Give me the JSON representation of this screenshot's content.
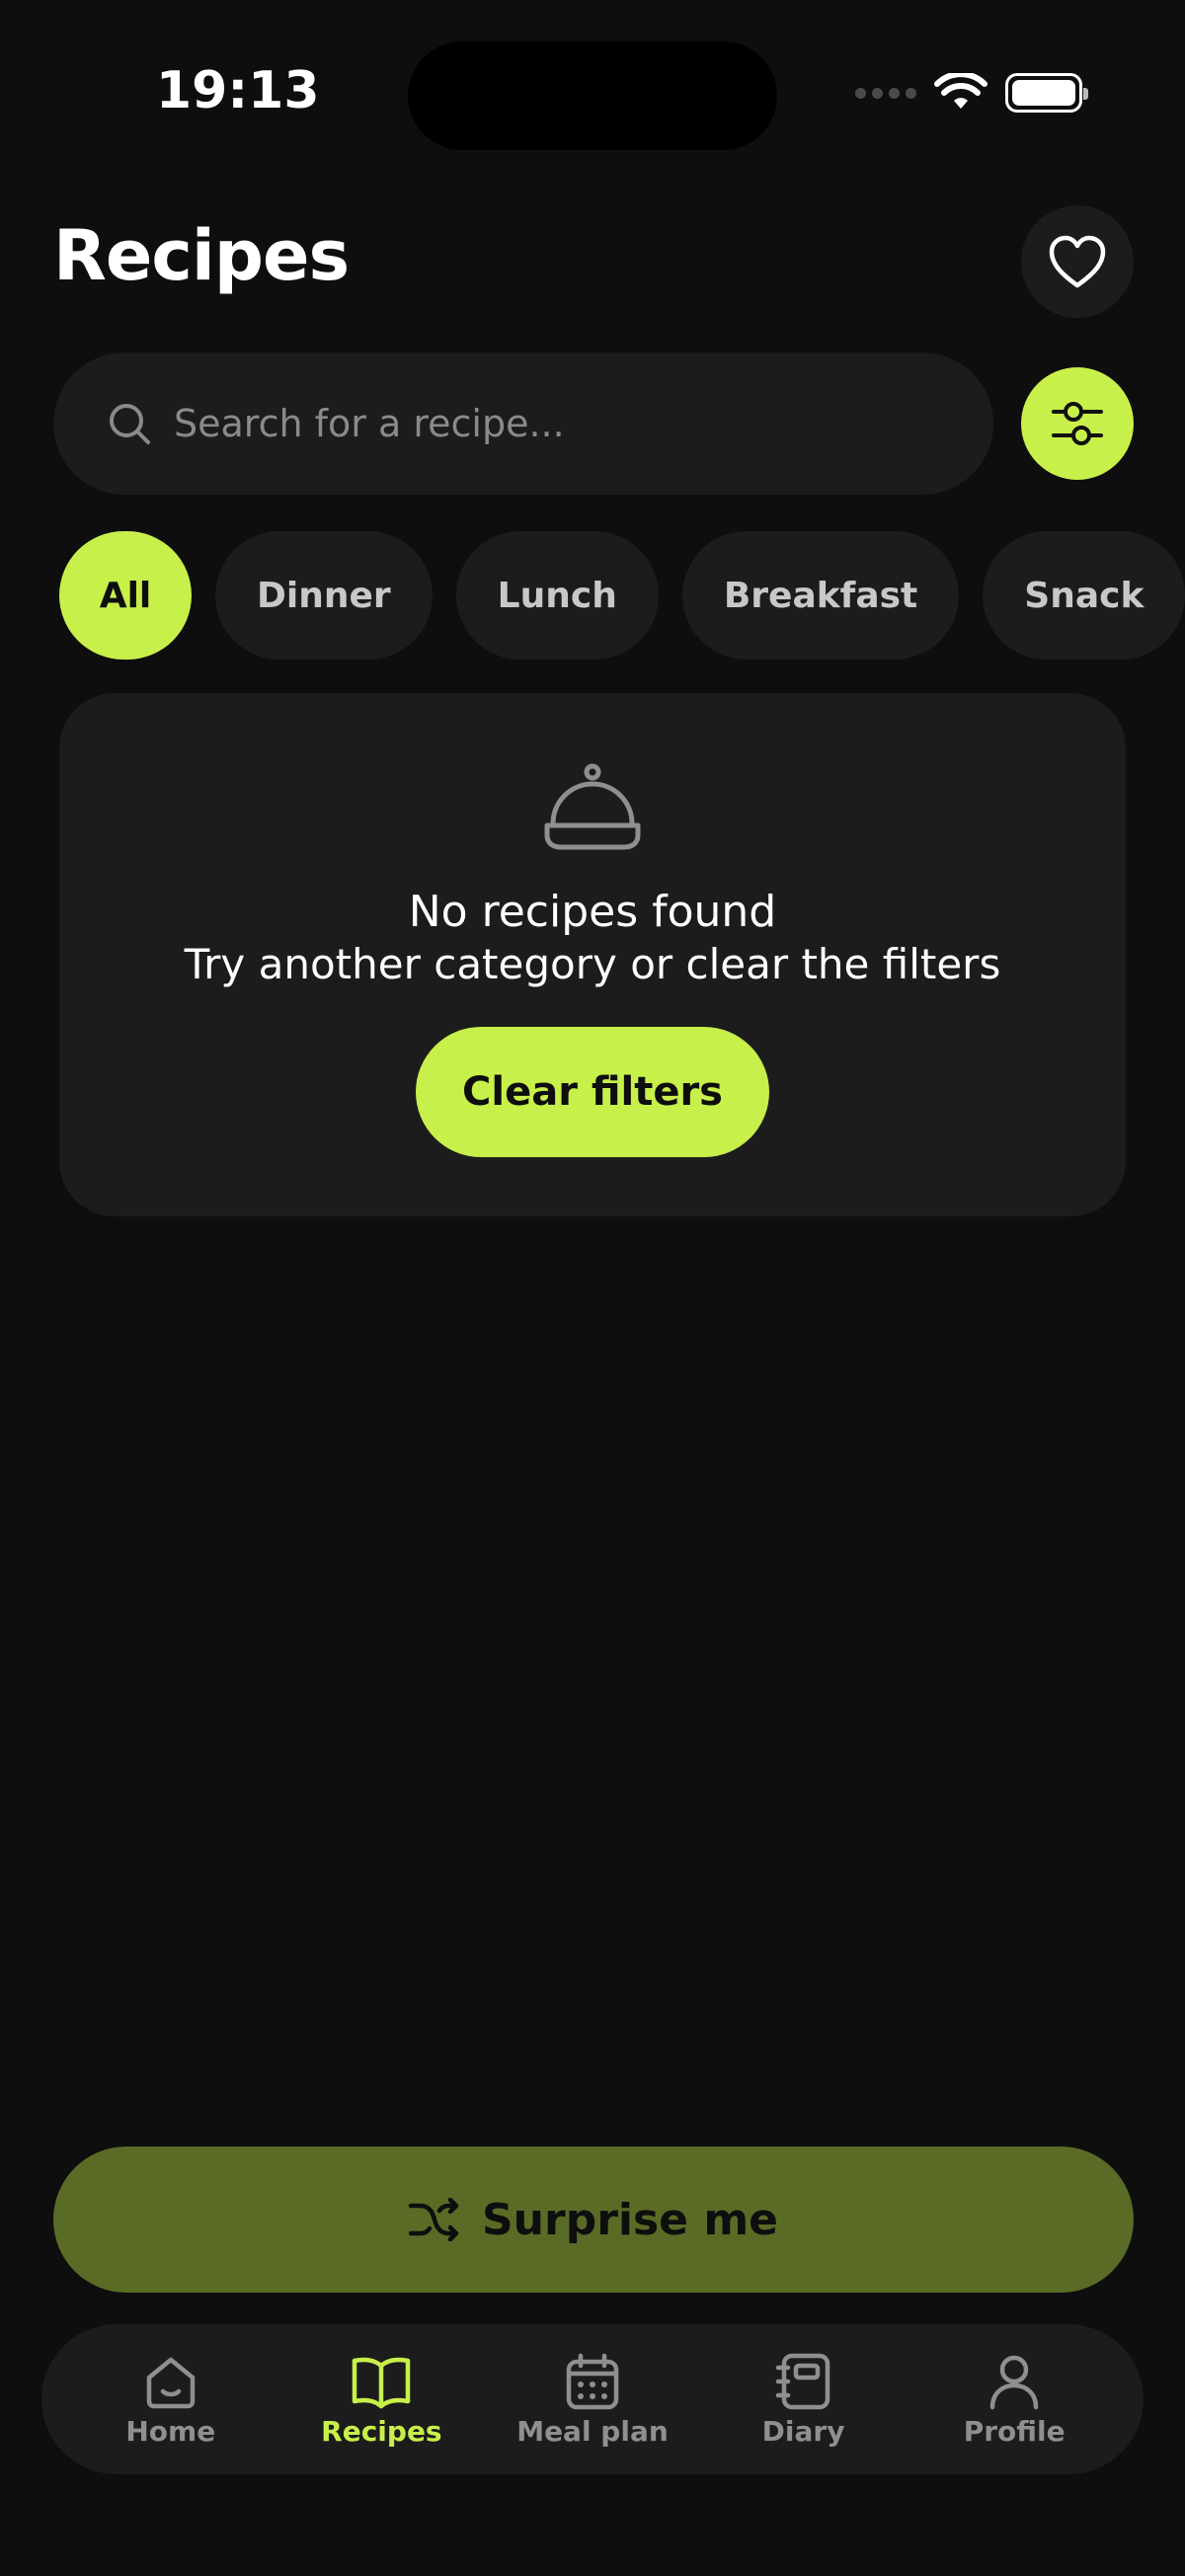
{
  "status_bar": {
    "time": "19:13"
  },
  "header": {
    "title": "Recipes"
  },
  "search": {
    "placeholder": "Search for a recipe..."
  },
  "categories": [
    "All",
    "Dinner",
    "Lunch",
    "Breakfast",
    "Snack"
  ],
  "active_category": "All",
  "empty_state": {
    "title": "No recipes found",
    "subtitle": "Try another category or clear the filters",
    "button_label": "Clear filters",
    "icon": "cloche-icon"
  },
  "surprise": {
    "label": "Surprise me",
    "icon": "shuffle-icon"
  },
  "tabs": [
    {
      "label": "Home",
      "icon": "home-icon"
    },
    {
      "label": "Recipes",
      "icon": "book-icon"
    },
    {
      "label": "Meal plan",
      "icon": "calendar-icon"
    },
    {
      "label": "Diary",
      "icon": "diary-icon"
    },
    {
      "label": "Profile",
      "icon": "profile-icon"
    }
  ],
  "active_tab": "Recipes",
  "colors": {
    "accent": "#c8f04a",
    "background": "#0e0e0e",
    "surface": "#1c1c1c",
    "surprise_bg": "#5a6b26"
  }
}
